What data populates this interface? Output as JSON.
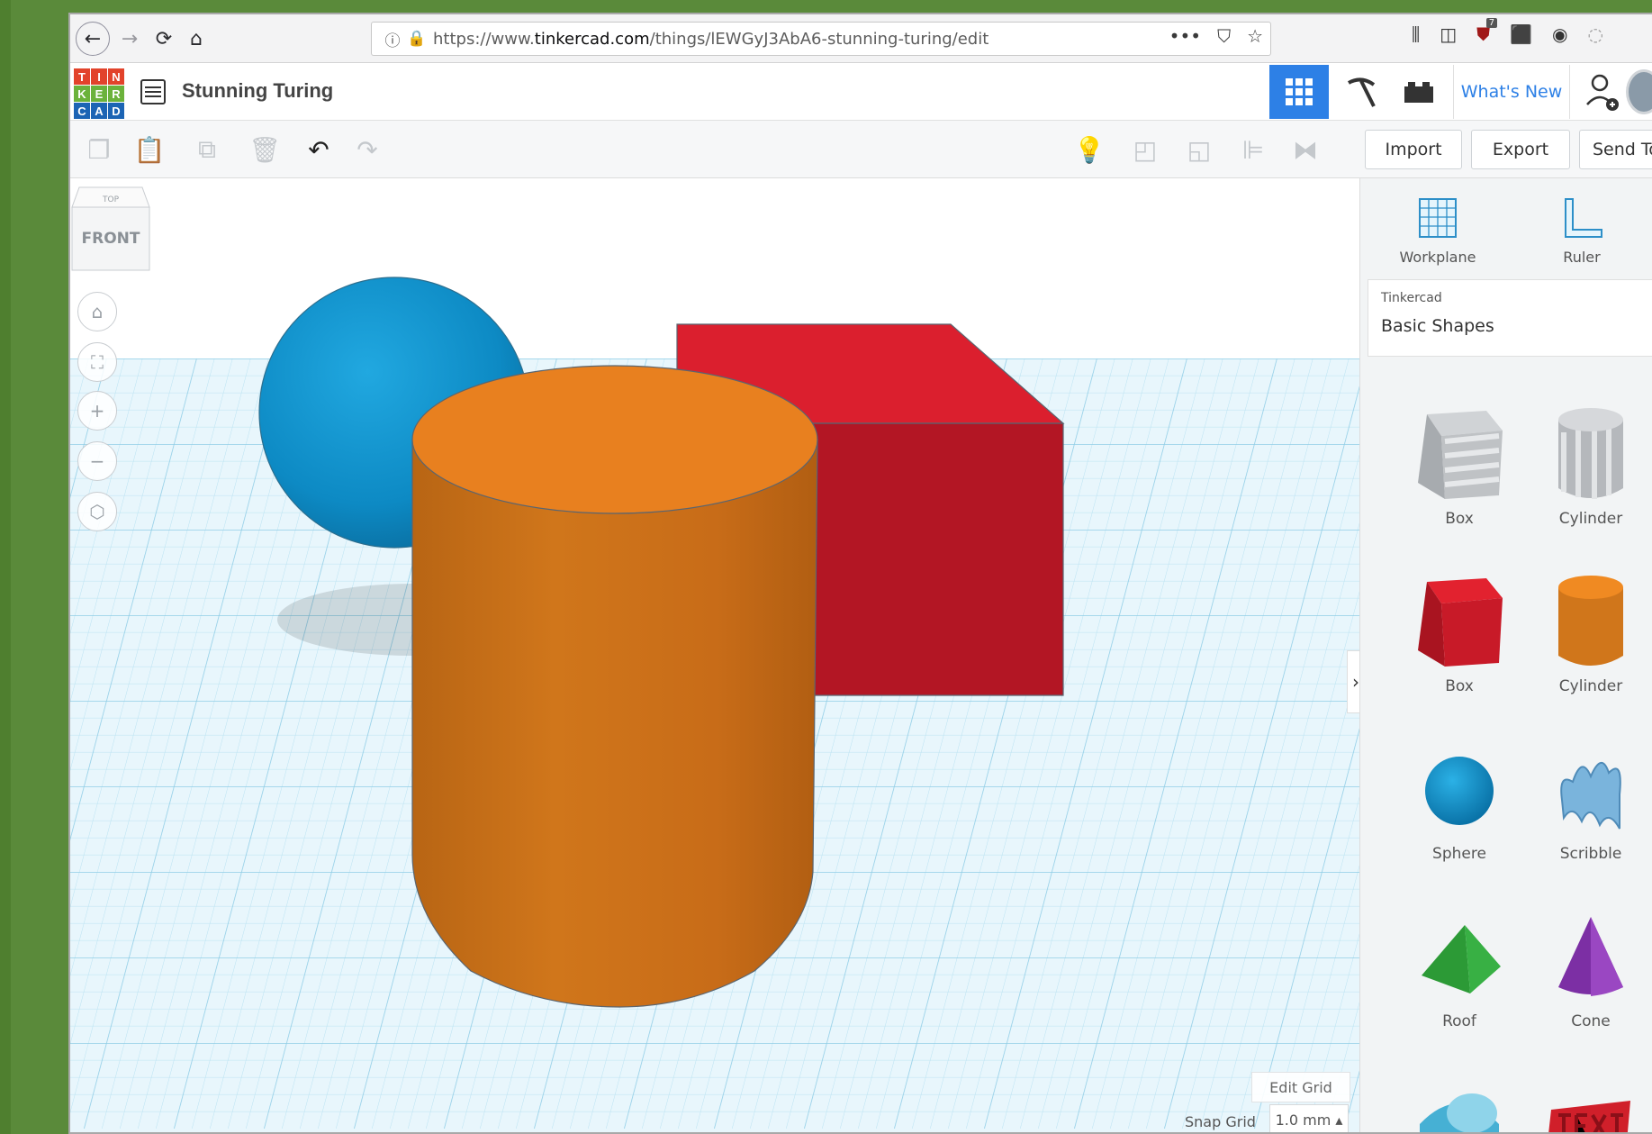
{
  "browser": {
    "url_prefix": "https://www.",
    "url_domain": "tinkercad.com",
    "url_path": "/things/lEWGyJ3AbA6-stunning-turing/edit",
    "ublock_count": "7",
    "url_menu": "•••"
  },
  "app": {
    "logo_letters": [
      "T",
      "I",
      "N",
      "K",
      "E",
      "R",
      "C",
      "A",
      "D"
    ],
    "logo_colors": [
      "#e2432b",
      "#e2432b",
      "#e2432b",
      "#6bb23b",
      "#6bb23b",
      "#6bb23b",
      "#1c64b4",
      "#1c64b4",
      "#1c64b4"
    ],
    "project_title": "Stunning Turing",
    "whats_new": "What's New",
    "accent": "#2d80e6"
  },
  "toolbar": {
    "import_label": "Import",
    "export_label": "Export",
    "send_to_label": "Send To"
  },
  "viewport": {
    "view_cube_top": "TOP",
    "view_cube_front": "FRONT",
    "edit_grid": "Edit Grid",
    "snap_grid_label": "Snap Grid",
    "snap_grid_value": "1.0 mm ▴"
  },
  "panel": {
    "workplane_label": "Workplane",
    "ruler_label": "Ruler",
    "category_source": "Tinkercad",
    "category_value": "Basic Shapes",
    "shapes": [
      {
        "label": "Box",
        "color": "#b9bcc0"
      },
      {
        "label": "Cylinder",
        "color": "#b9bcc0"
      },
      {
        "label": "Box",
        "color": "#d71f2b"
      },
      {
        "label": "Cylinder",
        "color": "#e8831f"
      },
      {
        "label": "Sphere",
        "color": "#1192d0"
      },
      {
        "label": "Scribble",
        "color": "#6aa6d4"
      },
      {
        "label": "Roof",
        "color": "#2fa83a"
      },
      {
        "label": "Cone",
        "color": "#7b2fa2"
      }
    ]
  }
}
